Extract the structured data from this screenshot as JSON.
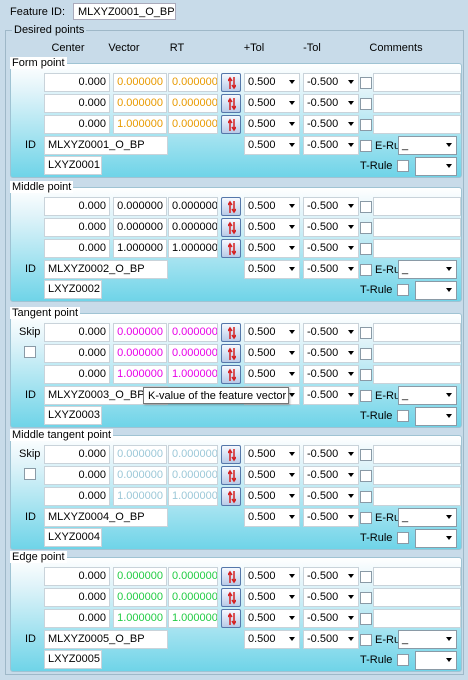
{
  "header": {
    "feature_id_label": "Feature ID:",
    "feature_id": "MLXYZ0001_O_BP"
  },
  "desired_points_label": "Desired points",
  "columns": {
    "center": "Center",
    "vector": "Vector",
    "rt": "RT",
    "plus_tol": "+Tol",
    "minus_tol": "-Tol",
    "comments": "Comments"
  },
  "labels": {
    "id": "ID",
    "e_rule": "E-Rule",
    "t_rule": "T-Rule",
    "skip": "Skip",
    "e_rule_value": "_"
  },
  "colors": {
    "orange": "#e89a00",
    "black": "#000000",
    "magenta": "#e800e8",
    "light": "#9cc8d8",
    "green": "#22cc44"
  },
  "tooltip": "K-value of the feature vector",
  "groups": [
    {
      "title": "Form point",
      "skip": false,
      "vec_color": "#e89a00",
      "rows": [
        {
          "center": "0.000",
          "vector": "0.000000",
          "rt": "0.000000",
          "plus": "0.500",
          "minus": "-0.500"
        },
        {
          "center": "0.000",
          "vector": "0.000000",
          "rt": "0.000000",
          "plus": "0.500",
          "minus": "-0.500"
        },
        {
          "center": "0.000",
          "vector": "1.000000",
          "rt": "0.000000",
          "plus": "0.500",
          "minus": "-0.500"
        }
      ],
      "id_plus": "0.500",
      "id_minus": "-0.500",
      "id": "MLXYZ0001_O_BP",
      "lid": "LXYZ0001"
    },
    {
      "title": "Middle point",
      "skip": false,
      "vec_color": "#000000",
      "rows": [
        {
          "center": "0.000",
          "vector": "0.000000",
          "rt": "0.000000",
          "plus": "0.500",
          "minus": "-0.500"
        },
        {
          "center": "0.000",
          "vector": "0.000000",
          "rt": "0.000000",
          "plus": "0.500",
          "minus": "-0.500"
        },
        {
          "center": "0.000",
          "vector": "1.000000",
          "rt": "1.000000",
          "plus": "0.500",
          "minus": "-0.500"
        }
      ],
      "id_plus": "0.500",
      "id_minus": "-0.500",
      "id": "MLXYZ0002_O_BP",
      "lid": "LXYZ0002"
    },
    {
      "title": "Tangent point",
      "skip": true,
      "vec_color": "#e800e8",
      "rows": [
        {
          "center": "0.000",
          "vector": "0.000000",
          "rt": "0.000000",
          "plus": "0.500",
          "minus": "-0.500"
        },
        {
          "center": "0.000",
          "vector": "0.000000",
          "rt": "0.000000",
          "plus": "0.500",
          "minus": "-0.500"
        },
        {
          "center": "0.000",
          "vector": "1.000000",
          "rt": "1.000000",
          "plus": "0.500",
          "minus": "-0.500"
        }
      ],
      "id_plus": "0.500",
      "id_minus": "-0.500",
      "id": "MLXYZ0003_O_BP",
      "lid": "LXYZ0003"
    },
    {
      "title": "Middle tangent point",
      "skip": true,
      "vec_color": "#9cc8d8",
      "rows": [
        {
          "center": "0.000",
          "vector": "0.000000",
          "rt": "0.000000",
          "plus": "0.500",
          "minus": "-0.500"
        },
        {
          "center": "0.000",
          "vector": "0.000000",
          "rt": "0.000000",
          "plus": "0.500",
          "minus": "-0.500"
        },
        {
          "center": "0.000",
          "vector": "1.000000",
          "rt": "1.000000",
          "plus": "0.500",
          "minus": "-0.500"
        }
      ],
      "id_plus": "0.500",
      "id_minus": "-0.500",
      "id": "MLXYZ0004_O_BP",
      "lid": "LXYZ0004"
    },
    {
      "title": "Edge point",
      "skip": false,
      "vec_color": "#22cc44",
      "rows": [
        {
          "center": "0.000",
          "vector": "0.000000",
          "rt": "0.000000",
          "plus": "0.500",
          "minus": "-0.500"
        },
        {
          "center": "0.000",
          "vector": "0.000000",
          "rt": "0.000000",
          "plus": "0.500",
          "minus": "-0.500"
        },
        {
          "center": "0.000",
          "vector": "1.000000",
          "rt": "1.000000",
          "plus": "0.500",
          "minus": "-0.500"
        }
      ],
      "id_plus": "0.500",
      "id_minus": "-0.500",
      "id": "MLXYZ0005_O_BP",
      "lid": "LXYZ0005"
    }
  ]
}
